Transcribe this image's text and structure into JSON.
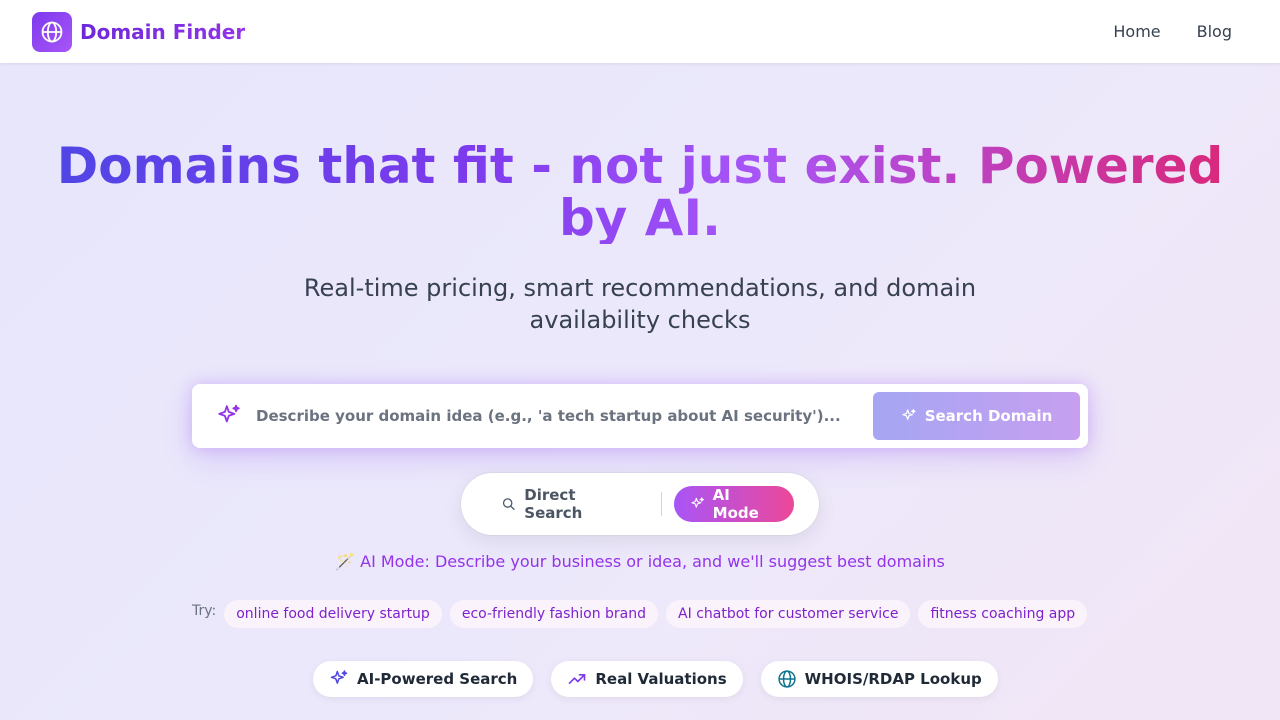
{
  "brand": {
    "name": "Domain Finder",
    "logo_icon": "globe-icon"
  },
  "nav": {
    "items": [
      {
        "label": "Home"
      },
      {
        "label": "Blog"
      }
    ]
  },
  "hero": {
    "title": "Domains that fit - not just exist. Powered by AI.",
    "subtitle": "Real-time pricing, smart recommendations, and domain availability checks"
  },
  "search": {
    "placeholder": "Describe your domain idea (e.g., 'a tech startup about AI security')...",
    "value": "",
    "button_label": "Search Domain",
    "icon": "sparkles-icon"
  },
  "modes": {
    "direct_label": "Direct Search",
    "ai_label": "AI Mode",
    "active": "AI Mode"
  },
  "mode_hint": {
    "emoji": "🪄",
    "text": "AI Mode: Describe your business or idea, and we'll suggest best domains"
  },
  "try": {
    "label": "Try:",
    "examples": [
      "online food delivery startup",
      "eco-friendly fashion brand",
      "AI chatbot for customer service",
      "fitness coaching app"
    ]
  },
  "features": [
    {
      "label": "AI-Powered Search",
      "icon": "sparkles-icon"
    },
    {
      "label": "Real Valuations",
      "icon": "trending-up-icon"
    },
    {
      "label": "WHOIS/RDAP Lookup",
      "icon": "globe-icon"
    }
  ],
  "colors": {
    "primary": "#7c3aed",
    "accent": "#a855f7",
    "pink": "#ec4899",
    "teal": "#0e7490"
  }
}
